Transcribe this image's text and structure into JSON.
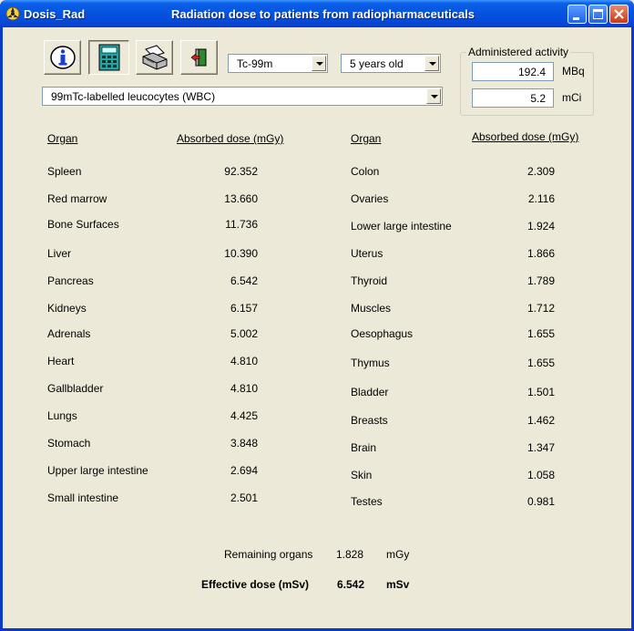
{
  "titlebar": {
    "app_name": "Dosis_Rad",
    "title": "Radiation dose to patients from radiopharmaceuticals"
  },
  "toolbar": {
    "buttons": [
      {
        "icon": "info-icon"
      },
      {
        "icon": "calculator-icon",
        "pressed": true
      },
      {
        "icon": "printer-icon"
      },
      {
        "icon": "exit-icon"
      }
    ]
  },
  "selectors": {
    "isotope": "Tc-99m",
    "age": "5 years old",
    "compound": "99mTc-labelled leucocytes (WBC)"
  },
  "activity": {
    "label": "Administered activity",
    "mbq_value": "192.4",
    "mbq_unit": "MBq",
    "mci_value": "5.2",
    "mci_unit": "mCi"
  },
  "table": {
    "organ_header": "Organ",
    "dose_header": "Absorbed dose (mGy)",
    "left": [
      {
        "organ": "Spleen",
        "dose": "92.352"
      },
      {
        "organ": "Red marrow",
        "dose": "13.660"
      },
      {
        "organ": "Bone Surfaces",
        "dose": "11.736"
      },
      {
        "organ": "Liver",
        "dose": "10.390"
      },
      {
        "organ": "Pancreas",
        "dose": "6.542"
      },
      {
        "organ": "Kidneys",
        "dose": "6.157"
      },
      {
        "organ": "Adrenals",
        "dose": "5.002"
      },
      {
        "organ": "Heart",
        "dose": "4.810"
      },
      {
        "organ": "Gallbladder",
        "dose": "4.810"
      },
      {
        "organ": "Lungs",
        "dose": "4.425"
      },
      {
        "organ": "Stomach",
        "dose": "3.848"
      },
      {
        "organ": "Upper large intestine",
        "dose": "2.694"
      },
      {
        "organ": "Small intestine",
        "dose": "2.501"
      }
    ],
    "right": [
      {
        "organ": "Colon",
        "dose": "2.309"
      },
      {
        "organ": "Ovaries",
        "dose": "2.116"
      },
      {
        "organ": "Lower large intestine",
        "dose": "1.924"
      },
      {
        "organ": "Uterus",
        "dose": "1.866"
      },
      {
        "organ": "Thyroid",
        "dose": "1.789"
      },
      {
        "organ": "Muscles",
        "dose": "1.712"
      },
      {
        "organ": "Oesophagus",
        "dose": "1.655"
      },
      {
        "organ": "Thymus",
        "dose": "1.655"
      },
      {
        "organ": "Bladder",
        "dose": "1.501"
      },
      {
        "organ": "Breasts",
        "dose": "1.462"
      },
      {
        "organ": "Brain",
        "dose": "1.347"
      },
      {
        "organ": "Skin",
        "dose": "1.058"
      },
      {
        "organ": "Testes",
        "dose": "0.981"
      }
    ]
  },
  "summary": {
    "remaining_label": "Remaining organs",
    "remaining_value": "1.828",
    "remaining_unit": "mGy",
    "effective_label": "Effective dose (mSv)",
    "effective_value": "6.542",
    "effective_unit": "mSv"
  }
}
